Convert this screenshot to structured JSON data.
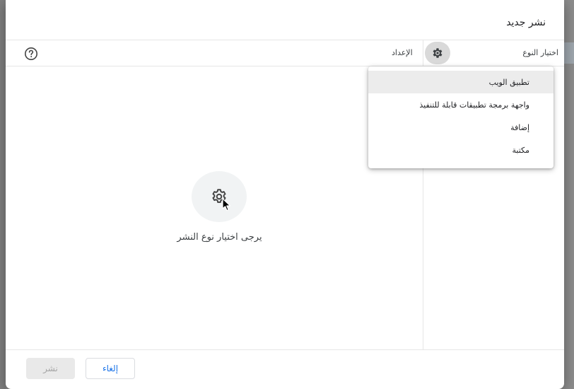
{
  "dialog": {
    "title": "نشر جديد",
    "select_type_label": "اختيار النوع",
    "config_label": "الإعداد",
    "empty_message": "يرجى اختيار نوع النشر"
  },
  "menu": {
    "items": [
      {
        "label": "تطبيق الويب"
      },
      {
        "label": "واجهة برمجة تطبيقات قابلة للتنفيذ"
      },
      {
        "label": "إضافة"
      },
      {
        "label": "مكتبة"
      }
    ]
  },
  "footer": {
    "deploy_label": "نشر",
    "cancel_label": "إلغاء"
  },
  "icons": {
    "settings": "gear-icon",
    "help": "help-icon",
    "cursor": "pointer-cursor-icon"
  },
  "colors": {
    "accent": "#1a73e8",
    "disabled_text": "#a6a6a6",
    "menu_active_bg": "#ececec"
  }
}
